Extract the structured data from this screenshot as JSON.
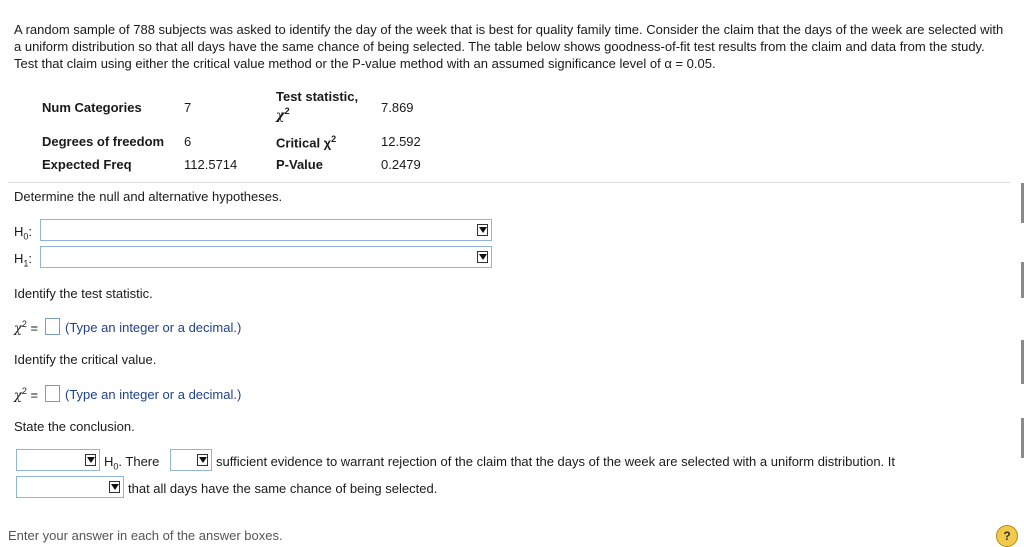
{
  "problem_text": "A random sample of 788 subjects was asked to identify the day of the week that is best for quality family time. Consider the claim that the days of the week are selected with a uniform distribution so that all days have the same chance of being selected. The table below shows goodness-of-fit test results from the claim and data from the study. Test that claim using either the critical value method or the P-value method with an assumed significance level of α = 0.05.",
  "table": {
    "num_categories_label": "Num Categories",
    "num_categories_value": "7",
    "df_label": "Degrees of freedom",
    "df_value": "6",
    "expected_label": "Expected Freq",
    "expected_value": "112.5714",
    "test_stat_label": "Test statistic,",
    "test_stat_symbol": "χ",
    "test_stat_sup": "2",
    "test_stat_value": "7.869",
    "critical_label": "Critical χ",
    "critical_sup": "2",
    "critical_value": "12.592",
    "pvalue_label": "P-Value",
    "pvalue_value": "0.2479"
  },
  "q1": {
    "prompt": "Determine the null and alternative hypotheses.",
    "h0_label": "H",
    "h0_sub": "0",
    "h1_label": "H",
    "h1_sub": "1",
    "colon": ":"
  },
  "q2": {
    "prompt": "Identify the test statistic.",
    "symbol": "χ",
    "sup": "2",
    "eq": "=",
    "hint": "(Type an integer or a decimal.)"
  },
  "q3": {
    "prompt": "Identify the critical value.",
    "symbol": "χ",
    "sup": "2",
    "eq": "=",
    "hint": "(Type an integer or a decimal.)"
  },
  "q4": {
    "prompt": "State the conclusion.",
    "h_label": "H",
    "h_sub": "0",
    "there": ". There",
    "line1_tail": "sufficient evidence to warrant rejection of the claim that the days of the week are selected with a uniform distribution. It",
    "line2_tail": "that all days have the same chance of being selected."
  },
  "footer_text": "Enter your answer in each of the answer boxes.",
  "icons": {
    "dropdown": "triangle-down-icon",
    "help": "help-icon"
  },
  "colors": {
    "field_border": "#8fb3d9",
    "hint_text": "#1f3f8f"
  }
}
